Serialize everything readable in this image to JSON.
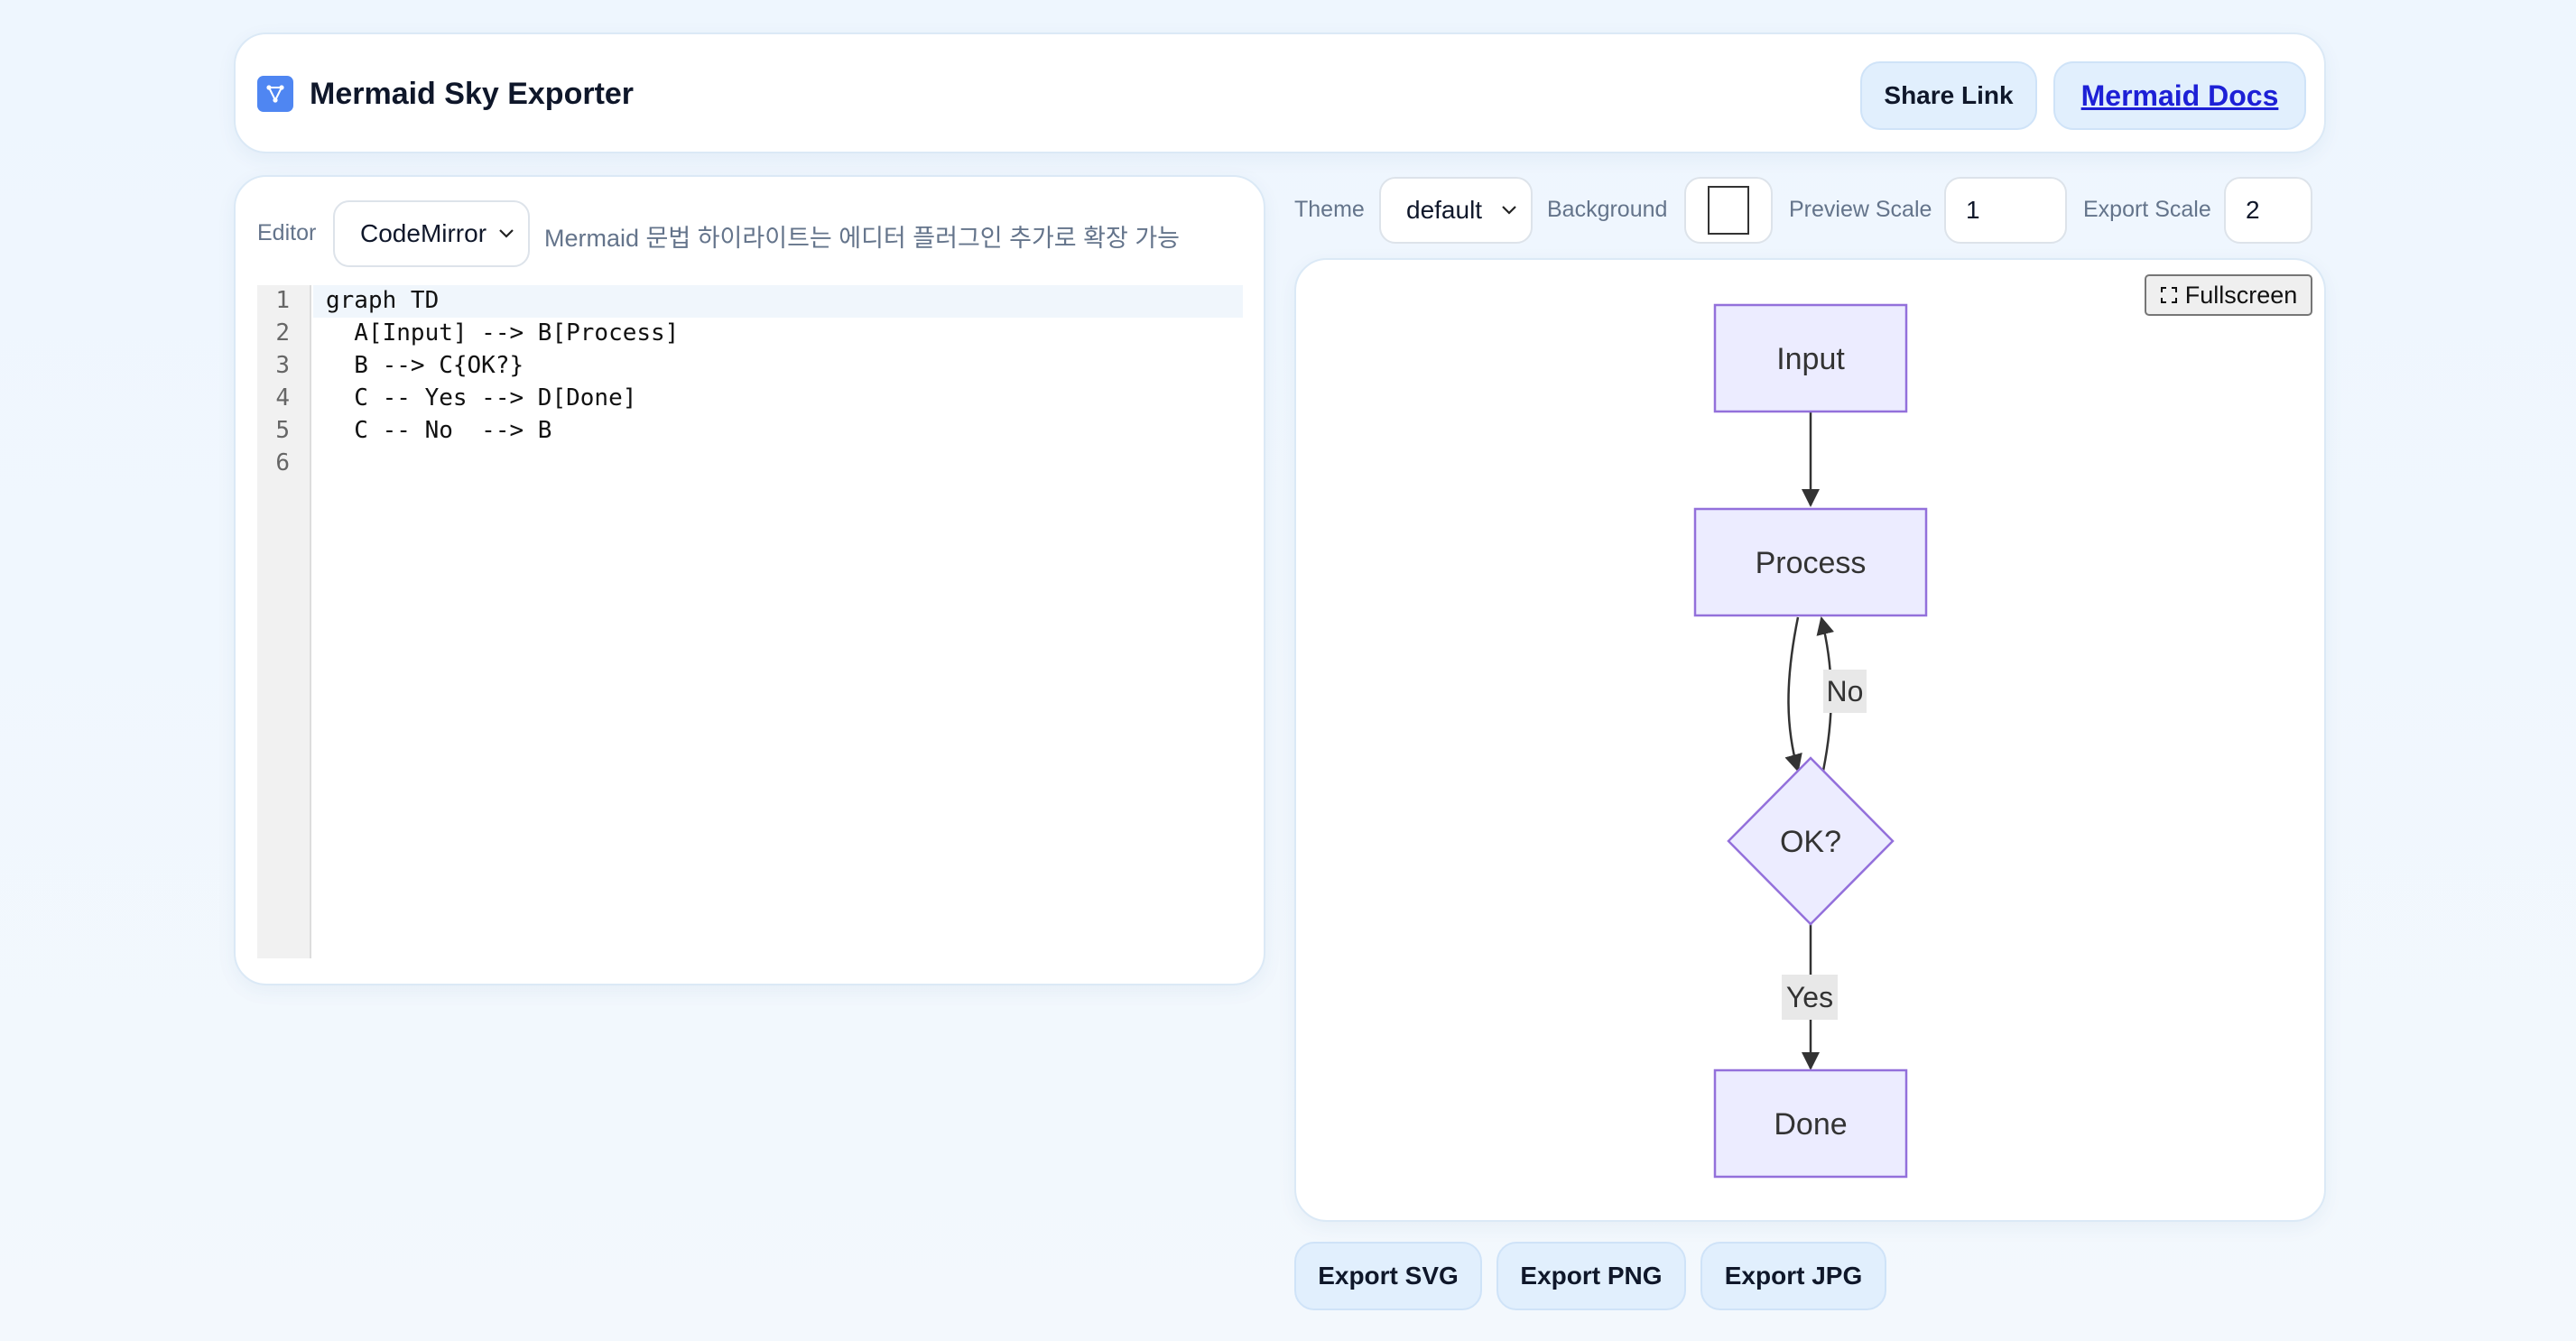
{
  "app": {
    "title": "Mermaid Sky Exporter",
    "share_label": "Share Link",
    "docs_label": "Mermaid Docs"
  },
  "editor": {
    "label": "Editor",
    "selected": "CodeMirror",
    "hint": "Mermaid 문법 하이라이트는 에디터 플러그인 추가로 확장 가능",
    "line_numbers": [
      "1",
      "2",
      "3",
      "4",
      "5",
      "6"
    ],
    "lines": [
      "graph TD",
      "  A[Input] --> B[Process]",
      "  B --> C{OK?}",
      "  C -- Yes --> D[Done]",
      "  C -- No  --> B",
      ""
    ]
  },
  "controls": {
    "theme_label": "Theme",
    "theme_value": "default",
    "background_label": "Background",
    "background_color": "#ffffff",
    "preview_scale_label": "Preview Scale",
    "preview_scale_value": "1",
    "export_scale_label": "Export Scale",
    "export_scale_value": "2"
  },
  "preview": {
    "fullscreen_label": "Fullscreen",
    "nodes": {
      "input": "Input",
      "process": "Process",
      "ok": "OK?",
      "done": "Done"
    },
    "edge_labels": {
      "no": "No",
      "yes": "Yes"
    },
    "node_fill": "#ececff",
    "node_stroke": "#9370db"
  },
  "export": {
    "svg_label": "Export SVG",
    "png_label": "Export PNG",
    "jpg_label": "Export JPG"
  },
  "colors": {
    "accent": "#4f86f2",
    "button_bg": "#e1effd",
    "link": "#1d20d6"
  }
}
